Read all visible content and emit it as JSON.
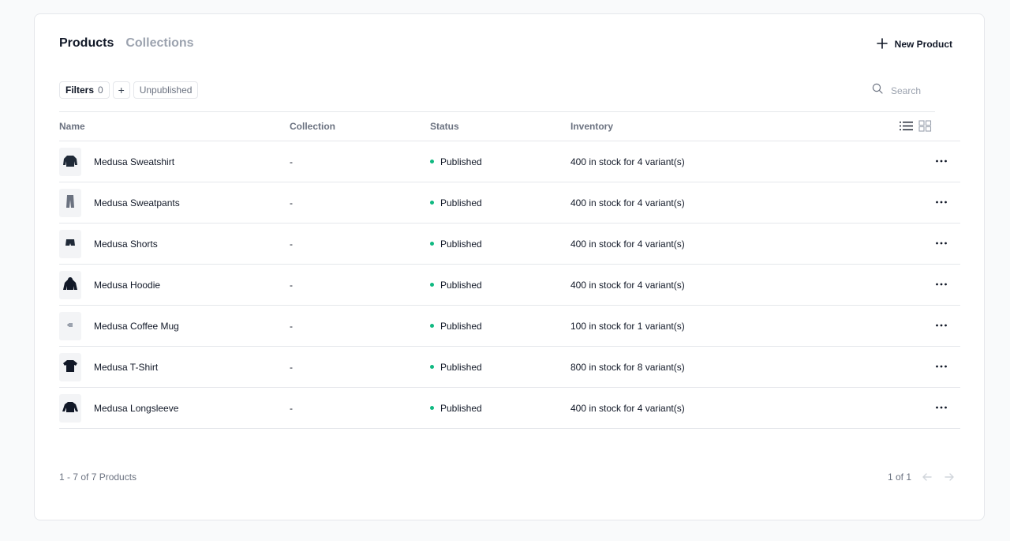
{
  "tabs": [
    {
      "label": "Products",
      "active": true
    },
    {
      "label": "Collections",
      "active": false
    }
  ],
  "toolbar": {
    "new_product_label": "New Product"
  },
  "filters": {
    "label": "Filters",
    "count": "0",
    "add_symbol": "+",
    "chips": [
      "Unpublished"
    ]
  },
  "search": {
    "placeholder": "Search"
  },
  "table": {
    "columns": [
      "Name",
      "Collection",
      "Status",
      "Inventory"
    ],
    "rows": [
      {
        "name": "Medusa Sweatshirt",
        "collection": "-",
        "status": "Published",
        "inventory": "400 in stock for 4 variant(s)",
        "icon": "sweatshirt-icon"
      },
      {
        "name": "Medusa Sweatpants",
        "collection": "-",
        "status": "Published",
        "inventory": "400 in stock for 4 variant(s)",
        "icon": "sweatpants-icon"
      },
      {
        "name": "Medusa Shorts",
        "collection": "-",
        "status": "Published",
        "inventory": "400 in stock for 4 variant(s)",
        "icon": "shorts-icon"
      },
      {
        "name": "Medusa Hoodie",
        "collection": "-",
        "status": "Published",
        "inventory": "400 in stock for 4 variant(s)",
        "icon": "hoodie-icon"
      },
      {
        "name": "Medusa Coffee Mug",
        "collection": "-",
        "status": "Published",
        "inventory": "100 in stock for 1 variant(s)",
        "icon": "mug-icon"
      },
      {
        "name": "Medusa T-Shirt",
        "collection": "-",
        "status": "Published",
        "inventory": "800 in stock for 8 variant(s)",
        "icon": "tshirt-icon"
      },
      {
        "name": "Medusa Longsleeve",
        "collection": "-",
        "status": "Published",
        "inventory": "400 in stock for 4 variant(s)",
        "icon": "longsleeve-icon"
      }
    ]
  },
  "footer": {
    "count_text": "1 - 7 of 7 Products",
    "page_text": "1 of 1"
  },
  "colors": {
    "status_published": "#10b981",
    "text_primary": "#111827",
    "text_muted": "#6b7280"
  }
}
